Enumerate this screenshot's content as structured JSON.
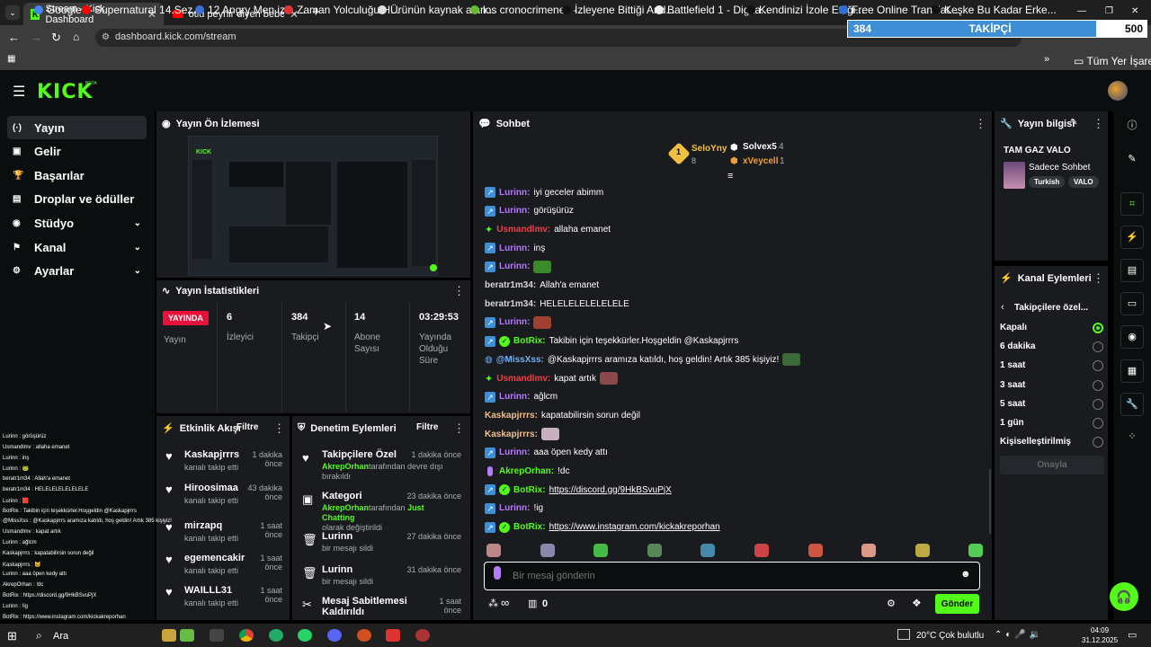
{
  "browser": {
    "tabs": [
      {
        "label": "Stream - Kick Dashboard",
        "active": true
      },
      {
        "label": "otlu peynir diyen bebek - YouTu",
        "active": false
      }
    ],
    "url": "dashboard.kick.com/stream",
    "new_tab": "+",
    "window_controls": [
      "—",
      "❐",
      "✕"
    ]
  },
  "bookmarks": [
    {
      "label": "Google",
      "color": "#4285f4"
    },
    {
      "label": "Supernatural 14.Sez...",
      "color": "#ff0000"
    },
    {
      "label": "12 Angry Men izle,...",
      "color": "#3a6fd8"
    },
    {
      "label": "Zaman Yolculuğu H...",
      "color": "#d33"
    },
    {
      "label": "Ürünün kaynak alan...",
      "color": "#ddd"
    },
    {
      "label": "los cronocrimenes -...",
      "color": "#6b3"
    },
    {
      "label": "İzleyene Bittiği And...",
      "color": "#111"
    },
    {
      "label": "Battlefield 1 - Digita...",
      "color": "#eee"
    },
    {
      "label": "Kendinizi İzole Ettiği...",
      "color": "#111"
    },
    {
      "label": "Free Online Translat...",
      "color": "#2a6fd8"
    },
    {
      "label": "Keşke Bu Kadar Erke...",
      "color": "#111"
    }
  ],
  "bookmarks_all": "Tüm Yer İşaretleri",
  "overlay": {
    "count": "384",
    "label": "TAKİPÇİ",
    "goal": "500"
  },
  "kick": {
    "logo": "KICK",
    "beta": "BETA"
  },
  "sidebar": [
    {
      "label": "Yayın",
      "icon": "broadcast-icon",
      "sel": true
    },
    {
      "label": "Gelir",
      "icon": "wallet-icon"
    },
    {
      "label": "Başarılar",
      "icon": "trophy-icon"
    },
    {
      "label": "Droplar ve ödüller",
      "icon": "gift-icon"
    },
    {
      "label": "Stüdyo",
      "icon": "camera-icon",
      "chev": true
    },
    {
      "label": "Kanal",
      "icon": "users-icon",
      "chev": true
    },
    {
      "label": "Ayarlar",
      "icon": "gear-icon",
      "chev": true
    }
  ],
  "preview": {
    "title": "Yayın Ön İzlemesi"
  },
  "stats": {
    "title": "Yayın İstatistikleri",
    "live": "YAYINDA",
    "live_sub": "Yayın",
    "items": [
      {
        "value": "6",
        "label": "İzleyici"
      },
      {
        "value": "384",
        "label": "Takipçi"
      },
      {
        "value": "14",
        "label": "Abone Sayısı"
      },
      {
        "value": "03:29:53",
        "label": "Yayında Olduğu Süre"
      }
    ]
  },
  "activity": {
    "title": "Etkinlik Akışı",
    "filter": "Filtre",
    "items": [
      {
        "name": "Kaskapjrrrs",
        "time": "1 dakika önce",
        "sub": "kanalı takip etti"
      },
      {
        "name": "Hiroosimaa",
        "time": "43 dakika önce",
        "sub": "kanalı takip etti"
      },
      {
        "name": "mirzapq",
        "time": "1 saat önce",
        "sub": "kanalı takip etti"
      },
      {
        "name": "egemencakir",
        "time": "1 saat önce",
        "sub": "kanalı takip etti"
      },
      {
        "name": "WAILLL31",
        "time": "1 saat önce",
        "sub": "kanalı takip etti"
      }
    ]
  },
  "moderation": {
    "title": "Denetim Eylemleri",
    "filter": "Filtre",
    "items": [
      {
        "name": "Takipçilere Özel",
        "time": "1 dakika önce",
        "user": "AkrepOrhan",
        "sub": "tarafından devre dışı bırakıldı",
        "icon": "heart-icon"
      },
      {
        "name": "Kategori",
        "time": "23 dakika önce",
        "user": "AkrepOrhan",
        "sub": "tarafından",
        "extra": "Just Chatting",
        "sub2": "olarak değiştirildi",
        "icon": "category-icon"
      },
      {
        "name": "Lurinn",
        "time": "27 dakika önce",
        "sub": "bir mesajı sildi",
        "icon": "trash-icon"
      },
      {
        "name": "Lurinn",
        "time": "31 dakika önce",
        "sub": "bir mesajı sildi",
        "icon": "trash-icon"
      },
      {
        "name": "Mesaj Sabitlemesi Kaldırıldı",
        "time": "1 saat önce",
        "icon": "unpin-icon"
      }
    ]
  },
  "chat": {
    "title": "Sohbet",
    "leaders": [
      {
        "name": "SeloYny",
        "count": "8",
        "color": "#f0c040"
      },
      {
        "name": "Solvex5",
        "count": "4",
        "color": "#fff"
      },
      {
        "name": "xVeycell",
        "count": "1",
        "color": "#f0a030"
      }
    ],
    "messages": [
      {
        "badge": "kb",
        "user": "Lurinn",
        "color": "#b57cf7",
        "text": "iyi geceler abimm"
      },
      {
        "badge": "kb",
        "user": "Lurinn",
        "color": "#b57cf7",
        "text": "görüşürüz"
      },
      {
        "badge": "star",
        "user": "Usmandlmv",
        "color": "#e8434a",
        "text": "allaha emanet"
      },
      {
        "badge": "kb",
        "user": "Lurinn",
        "color": "#b57cf7",
        "text": "inş"
      },
      {
        "badge": "kb",
        "user": "Lurinn",
        "color": "#b57cf7",
        "text": "",
        "emote": "#3a8a2a"
      },
      {
        "badge": "",
        "user": "beratr1m34",
        "color": "#d8d8d8",
        "text": "Allah'a emanet"
      },
      {
        "badge": "",
        "user": "beratr1m34",
        "color": "#d8d8d8",
        "text": "HELELELELELELELE"
      },
      {
        "badge": "kb",
        "user": "Lurinn",
        "color": "#b57cf7",
        "text": "",
        "emote": "#a04030"
      },
      {
        "badge": "kbv",
        "user": "BotRix",
        "color": "#53fc18",
        "text": "Takibin için teşekkürler.Hoşgeldin @Kaskapjrrrs"
      },
      {
        "badge": "bot",
        "user": "@MissXss",
        "color": "#74b3f7",
        "text": "@Kaskapjrrrs aramıza katıldı, hoş geldin! Artık 385 kişiyiz!",
        "emote": "#3a6a3a"
      },
      {
        "badge": "star",
        "user": "Usmandlmv",
        "color": "#e8434a",
        "text": "kapat artık",
        "emote": "#8a4a4a"
      },
      {
        "badge": "kb",
        "user": "Lurinn",
        "color": "#b57cf7",
        "text": "ağlcm"
      },
      {
        "badge": "",
        "user": "Kaskapjrrrs",
        "color": "#f0c090",
        "text": "kapatabilirsin sorun değil"
      },
      {
        "badge": "",
        "user": "Kaskapjrrrs",
        "color": "#f0c090",
        "text": "",
        "emote": "#c8b0c0"
      },
      {
        "badge": "kb",
        "user": "Lurinn",
        "color": "#b57cf7",
        "text": "aaa öpen kedy attı"
      },
      {
        "badge": "mic",
        "user": "AkrepOrhan",
        "color": "#53fc18",
        "text": "!dc"
      },
      {
        "badge": "kbv",
        "user": "BotRix",
        "color": "#53fc18",
        "text": "https://discord.gg/9HkBSvuPjX",
        "link": true
      },
      {
        "badge": "kb",
        "user": "Lurinn",
        "color": "#b57cf7",
        "text": "!ig"
      },
      {
        "badge": "kbv",
        "user": "BotRix",
        "color": "#53fc18",
        "text": "https://www.instagram.com/kickakreporhan",
        "link": true
      }
    ],
    "emote_bar": [
      "#b88",
      "#88a",
      "#4b4",
      "#585",
      "#48a",
      "#c44",
      "#c54",
      "#d98",
      "#ba4",
      "#5c5"
    ],
    "placeholder": "Bir mesaj gönderin",
    "send": "Gönder",
    "infinity": "∞",
    "points": "0"
  },
  "info": {
    "title": "Yayın bilgisi",
    "stream_title": "TAM GAZ VALO",
    "category": "Sadece Sohbet",
    "tags": [
      "Turkish",
      "VALO"
    ]
  },
  "channel_actions": {
    "title": "Kanal Eylemleri",
    "sub": "Takipçilere özel...",
    "options": [
      "Kapalı",
      "6 dakika",
      "1 saat",
      "3 saat",
      "5 saat",
      "1 gün",
      "Kişiselleştirilmiş"
    ],
    "selected": 0,
    "apply": "Onayla"
  },
  "left_overlay_chat": [
    "Lurinn : görüşürüz",
    "Usmandlmv : allaha emanet",
    "Lurinn : inş",
    "Lurinn : 🐸",
    "beratr1m34 : Allah'a emanet",
    "beratr1m34 : HELELELELELELELE",
    "Lurinn : 🟥",
    "BotRix : Takibin için teşekkürler.Hoşgeldin @Kaskapjrrrs",
    "@MissXss : @Kaskapjrrrs aramıza katıldı, hoş geldin! Artık 385 kişiyiz!",
    "Usmandlmv : kapat artık",
    "Lurinn : ağlcm",
    "Kaskapjrrrs : kapatabilirsin sorun değil",
    "Kaskapjrrrs : 🐱",
    "Lurinn : aaa öpen kedy attı",
    "AkrepOrhan : !dc",
    "BotRix : https://discord.gg/9HkBSvuPjX",
    "Lurinn : !ig",
    "BotRix : https://www.instagram.com/kickakreporhan"
  ],
  "taskbar": {
    "search": "Ara",
    "weather": "20°C  Çok bulutlu",
    "time": "04:09",
    "date": "31.12.2025"
  }
}
